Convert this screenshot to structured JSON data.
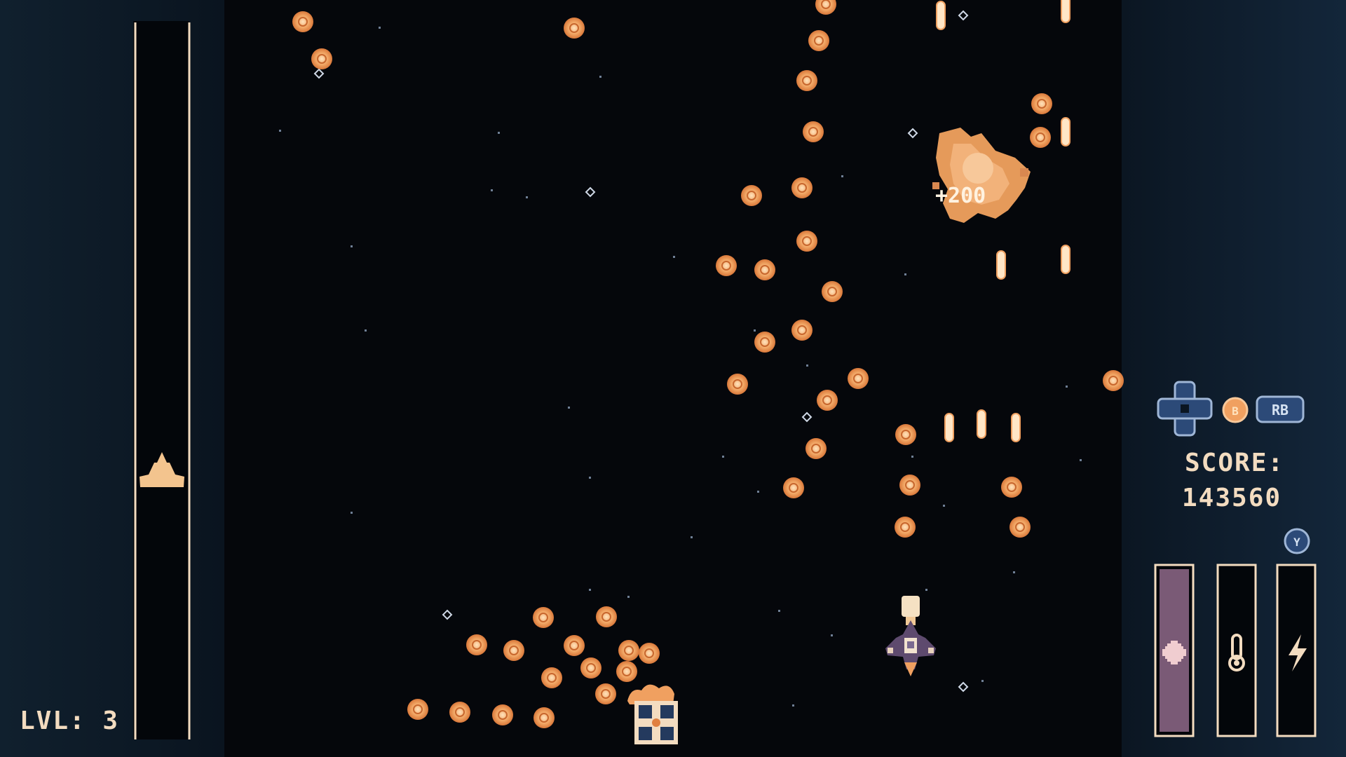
{
  "hud": {
    "level_label": "LVL: 3",
    "score_label": "SCORE:",
    "score_value": "143560",
    "floating_score": "+200",
    "button_b": "B",
    "button_rb": "RB",
    "button_y": "Y"
  },
  "meters": {
    "health_fill": 1.0,
    "heat_fill": 0.0,
    "energy_fill": 0.0
  },
  "progress": {
    "level_progress": 0.63
  },
  "colors": {
    "background": "#05070b",
    "side_panel": "#0e1b28",
    "ui_cream": "#f3dcc0",
    "bullet_orange": "#f0a060",
    "bullet_core": "#ffd7a8",
    "health_fill": "#7a5a76",
    "button_blue": "#2c4a78"
  },
  "icons": {
    "dpad": "dpad-icon",
    "health": "plus-icon",
    "heat": "thermometer-icon",
    "energy": "lightning-icon",
    "ship": "player-ship-icon",
    "progress_marker": "ship-marker-icon"
  }
}
